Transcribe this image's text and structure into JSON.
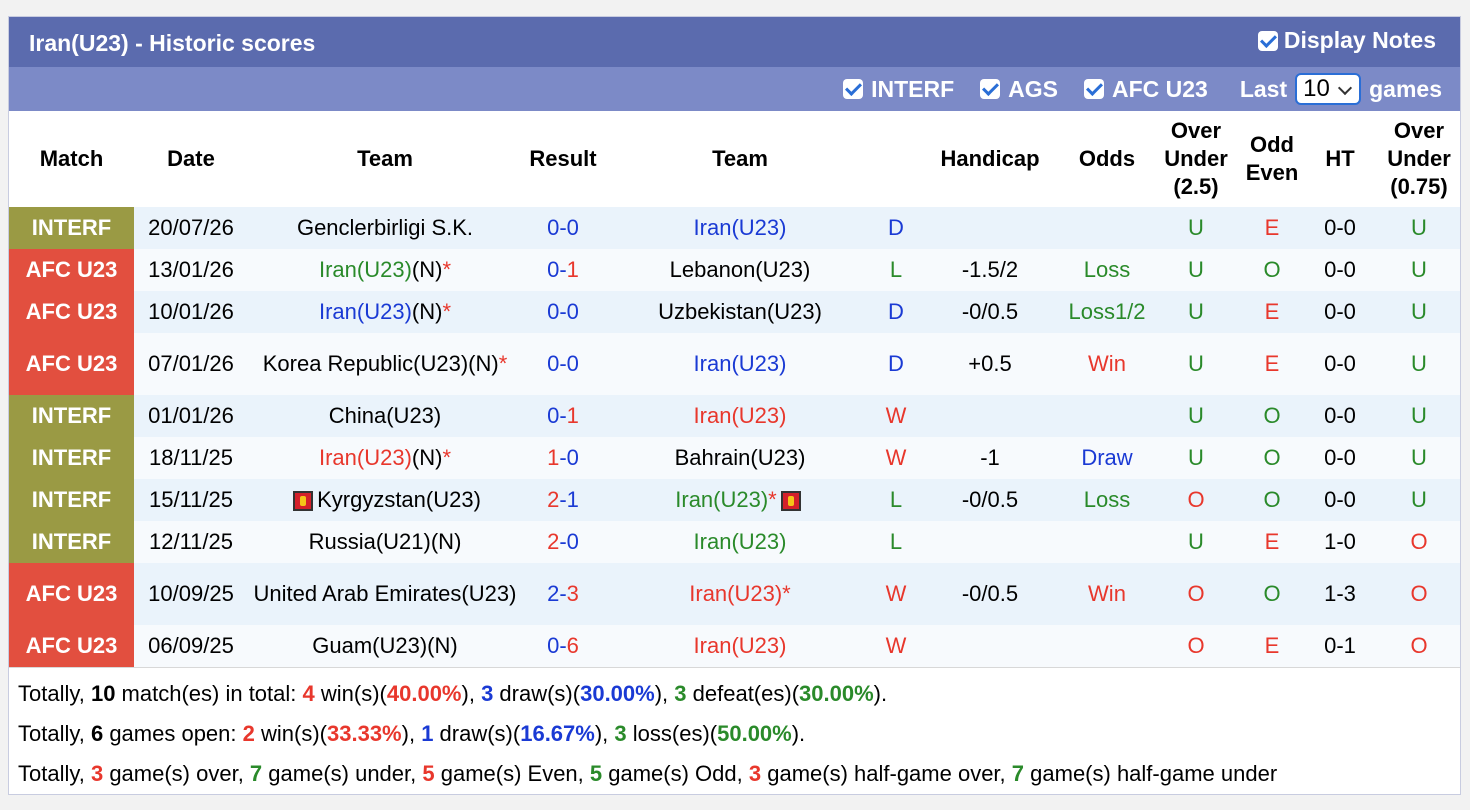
{
  "header": {
    "title": "Iran(U23) - Historic scores",
    "display_notes": "Display Notes"
  },
  "filters": {
    "items": [
      "INTERF",
      "AGS",
      "AFC U23"
    ],
    "last_label": "Last",
    "last_value": "10",
    "games_label": "games"
  },
  "columns": [
    "Match",
    "Date",
    "Team",
    "Result",
    "Team",
    "",
    "Handicap",
    "Odds",
    "Over Under (2.5)",
    "Odd Even",
    "HT",
    "Over Under (0.75)"
  ],
  "colors": {
    "interf": "#9a9a44",
    "afc": "#e24f3f",
    "header": "#5b6bae",
    "filterbar": "#7c8ac7"
  },
  "rows": [
    {
      "match": "INTERF",
      "type": "interf",
      "date": "20/07/26",
      "home": "Genclerbirligi S.K.",
      "home_color": "",
      "home_star": "",
      "result_h": "0",
      "result_a": "0",
      "result_color": "blue",
      "away": "Iran(U23)",
      "away_color": "blue",
      "away_star": "",
      "wdl": "D",
      "wdl_color": "blue",
      "hcap": "",
      "odds": "",
      "odds_color": "",
      "ou": "U",
      "ou_color": "green",
      "oe": "E",
      "oe_color": "red",
      "ht": "0-0",
      "ou2": "U",
      "ou2_color": "green",
      "tall": false
    },
    {
      "match": "AFC U23",
      "type": "afc",
      "date": "13/01/26",
      "home": "Iran(U23)",
      "home_suffix": "(N)",
      "home_color": "green",
      "home_star": "*",
      "result_h": "0",
      "result_a": "1",
      "result_color": "split",
      "away": "Lebanon(U23)",
      "away_color": "",
      "away_star": "",
      "wdl": "L",
      "wdl_color": "green",
      "hcap": "-1.5/2",
      "odds": "Loss",
      "odds_color": "green",
      "ou": "U",
      "ou_color": "green",
      "oe": "O",
      "oe_color": "green",
      "ht": "0-0",
      "ou2": "U",
      "ou2_color": "green",
      "tall": false
    },
    {
      "match": "AFC U23",
      "type": "afc",
      "date": "10/01/26",
      "home": "Iran(U23)",
      "home_suffix": "(N)",
      "home_color": "blue",
      "home_star": "*",
      "result_h": "0",
      "result_a": "0",
      "result_color": "blue",
      "away": "Uzbekistan(U23)",
      "away_color": "",
      "away_star": "",
      "wdl": "D",
      "wdl_color": "blue",
      "hcap": "-0/0.5",
      "odds": "Loss1/2",
      "odds_color": "green",
      "ou": "U",
      "ou_color": "green",
      "oe": "E",
      "oe_color": "red",
      "ht": "0-0",
      "ou2": "U",
      "ou2_color": "green",
      "tall": false
    },
    {
      "match": "AFC U23",
      "type": "afc",
      "date": "07/01/26",
      "home": "Korea Republic(U23)",
      "home_suffix": "(N)",
      "home_color": "",
      "home_star": "*",
      "result_h": "0",
      "result_a": "0",
      "result_color": "blue",
      "away": "Iran(U23)",
      "away_color": "blue",
      "away_star": "",
      "wdl": "D",
      "wdl_color": "blue",
      "hcap": "+0.5",
      "odds": "Win",
      "odds_color": "red",
      "ou": "U",
      "ou_color": "green",
      "oe": "E",
      "oe_color": "red",
      "ht": "0-0",
      "ou2": "U",
      "ou2_color": "green",
      "tall": true
    },
    {
      "match": "INTERF",
      "type": "interf",
      "date": "01/01/26",
      "home": "China(U23)",
      "home_color": "",
      "home_star": "",
      "result_h": "0",
      "result_a": "1",
      "result_color": "split",
      "away": "Iran(U23)",
      "away_color": "red",
      "away_star": "",
      "wdl": "W",
      "wdl_color": "red",
      "hcap": "",
      "odds": "",
      "odds_color": "",
      "ou": "U",
      "ou_color": "green",
      "oe": "O",
      "oe_color": "green",
      "ht": "0-0",
      "ou2": "U",
      "ou2_color": "green",
      "tall": false
    },
    {
      "match": "INTERF",
      "type": "interf",
      "date": "18/11/25",
      "home": "Iran(U23)",
      "home_suffix": "(N)",
      "home_color": "red",
      "home_star": "*",
      "result_h": "1",
      "result_a": "0",
      "result_color": "split2",
      "away": "Bahrain(U23)",
      "away_color": "",
      "away_star": "",
      "wdl": "W",
      "wdl_color": "red",
      "hcap": "-1",
      "odds": "Draw",
      "odds_color": "blue",
      "ou": "U",
      "ou_color": "green",
      "oe": "O",
      "oe_color": "green",
      "ht": "0-0",
      "ou2": "U",
      "ou2_color": "green",
      "tall": false
    },
    {
      "match": "INTERF",
      "type": "interf",
      "date": "15/11/25",
      "home": "Kyrgyzstan(U23)",
      "home_color": "",
      "home_star": "",
      "home_flag": true,
      "result_h": "2",
      "result_a": "1",
      "result_color": "split2",
      "away": "Iran(U23)",
      "away_color": "green",
      "away_star": "*",
      "away_flag": true,
      "wdl": "L",
      "wdl_color": "green",
      "hcap": "-0/0.5",
      "odds": "Loss",
      "odds_color": "green",
      "ou": "O",
      "ou_color": "red",
      "oe": "O",
      "oe_color": "green",
      "ht": "0-0",
      "ou2": "U",
      "ou2_color": "green",
      "tall": false
    },
    {
      "match": "INTERF",
      "type": "interf",
      "date": "12/11/25",
      "home": "Russia(U21)(N)",
      "home_color": "",
      "home_star": "",
      "result_h": "2",
      "result_a": "0",
      "result_color": "split2",
      "away": "Iran(U23)",
      "away_color": "green",
      "away_star": "",
      "wdl": "L",
      "wdl_color": "green",
      "hcap": "",
      "odds": "",
      "odds_color": "",
      "ou": "U",
      "ou_color": "green",
      "oe": "E",
      "oe_color": "red",
      "ht": "1-0",
      "ou2": "O",
      "ou2_color": "red",
      "tall": false
    },
    {
      "match": "AFC U23",
      "type": "afc",
      "date": "10/09/25",
      "home": "United Arab Emirates(U23)",
      "home_color": "",
      "home_star": "",
      "result_h": "2",
      "result_a": "3",
      "result_color": "split",
      "away": "Iran(U23)",
      "away_color": "red",
      "away_star": "*",
      "wdl": "W",
      "wdl_color": "red",
      "hcap": "-0/0.5",
      "odds": "Win",
      "odds_color": "red",
      "ou": "O",
      "ou_color": "red",
      "oe": "O",
      "oe_color": "green",
      "ht": "1-3",
      "ou2": "O",
      "ou2_color": "red",
      "tall": true
    },
    {
      "match": "AFC U23",
      "type": "afc",
      "date": "06/09/25",
      "home": "Guam(U23)(N)",
      "home_color": "",
      "home_star": "",
      "result_h": "0",
      "result_a": "6",
      "result_color": "split",
      "away": "Iran(U23)",
      "away_color": "red",
      "away_star": "",
      "wdl": "W",
      "wdl_color": "red",
      "hcap": "",
      "odds": "",
      "odds_color": "",
      "ou": "O",
      "ou_color": "red",
      "oe": "E",
      "oe_color": "red",
      "ht": "0-1",
      "ou2": "O",
      "ou2_color": "red",
      "tall": false
    }
  ],
  "summary": [
    [
      [
        "Totally, ",
        ""
      ],
      [
        "10",
        "b"
      ],
      [
        " match(es) in total: ",
        ""
      ],
      [
        "4",
        "red b"
      ],
      [
        " win(s)(",
        ""
      ],
      [
        "40.00%",
        "red b"
      ],
      [
        "), ",
        ""
      ],
      [
        "3",
        "blue b"
      ],
      [
        " draw(s)(",
        ""
      ],
      [
        "30.00%",
        "blue b"
      ],
      [
        "), ",
        ""
      ],
      [
        "3",
        "green b"
      ],
      [
        " defeat(es)(",
        ""
      ],
      [
        "30.00%",
        "green b"
      ],
      [
        ").",
        ""
      ]
    ],
    [
      [
        "Totally, ",
        ""
      ],
      [
        "6",
        "b"
      ],
      [
        " games open: ",
        ""
      ],
      [
        "2",
        "red b"
      ],
      [
        " win(s)(",
        ""
      ],
      [
        "33.33%",
        "red b"
      ],
      [
        "), ",
        ""
      ],
      [
        "1",
        "blue b"
      ],
      [
        " draw(s)(",
        ""
      ],
      [
        "16.67%",
        "blue b"
      ],
      [
        "), ",
        ""
      ],
      [
        "3",
        "green b"
      ],
      [
        " loss(es)(",
        ""
      ],
      [
        "50.00%",
        "green b"
      ],
      [
        ").",
        ""
      ]
    ],
    [
      [
        "Totally, ",
        ""
      ],
      [
        "3",
        "red b"
      ],
      [
        " game(s) over, ",
        ""
      ],
      [
        "7",
        "green b"
      ],
      [
        " game(s) under, ",
        ""
      ],
      [
        "5",
        "red b"
      ],
      [
        " game(s) Even, ",
        ""
      ],
      [
        "5",
        "green b"
      ],
      [
        " game(s) Odd, ",
        ""
      ],
      [
        "3",
        "red b"
      ],
      [
        " game(s) half-game over, ",
        ""
      ],
      [
        "7",
        "green b"
      ],
      [
        " game(s) half-game under",
        ""
      ]
    ]
  ]
}
